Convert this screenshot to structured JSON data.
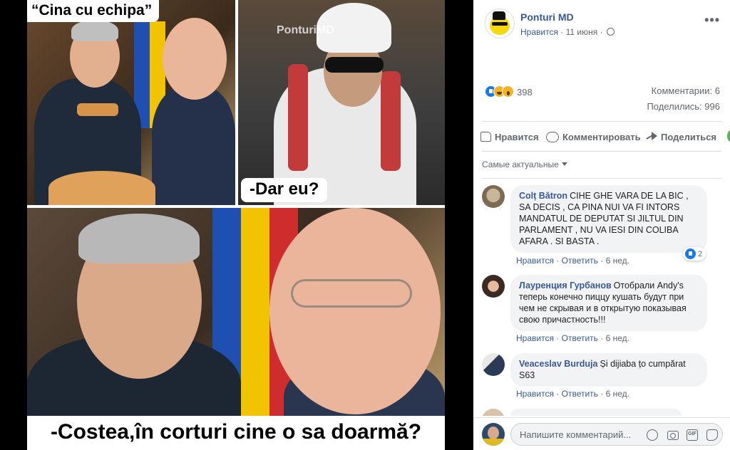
{
  "collage": {
    "caption_top": "“Cina cu echipa”",
    "caption_middle": "-Dar eu?",
    "caption_bottom": "-Costea,în corturi cine o sa doarmă?",
    "watermark": "PonturiMD"
  },
  "post": {
    "page_name": "Ponturi MD",
    "like_link": "Нравится",
    "date": "11 июня",
    "reactions_count": "398",
    "comments_count": "Комментарии: 6",
    "shares_count": "Поделились: 996",
    "actions": {
      "like": "Нравится",
      "comment": "Комментировать",
      "share": "Поделиться"
    },
    "sort_label": "Самые актуальные"
  },
  "comments": [
    {
      "author": "Colț Bătron",
      "text": "CIHE GHE VARA DE LA BIC , SA DECIS , CA PINA NUI VA FI INTORS MANDATUL DE DEPUTAT SI JILTUL DIN PARLAMENT , NU VA IESI DIN COLIBA AFARA . SI BASTA .",
      "like": "Нравится",
      "reply": "Ответить",
      "time": "6 нед.",
      "reaction_count": "2"
    },
    {
      "author": "Лауренция Гурбанов",
      "text": "Отобрали Andy's теперь конечно пиццу кушать будут при чем не скрывая и в открытую показывая свою причастность!!!",
      "like": "Нравится",
      "reply": "Ответить",
      "time": "6 нед."
    },
    {
      "author": "Veaceslav Burduja",
      "text": "Și dijiaba țo cumpărat S63",
      "like": "Нравится",
      "reply": "Ответить",
      "time": "6 нед."
    }
  ],
  "composer": {
    "placeholder": "Напишите комментарий..."
  },
  "icons": {
    "more": "more-options-icon",
    "privacy": "globe-icon",
    "emoji": "emoji-icon",
    "camera": "camera-icon",
    "gif": "gif-icon",
    "sticker": "sticker-icon"
  },
  "colors": {
    "link": "#385898",
    "meta": "#606770",
    "like_blue": "#1877f2",
    "bubble": "#f2f3f5"
  }
}
